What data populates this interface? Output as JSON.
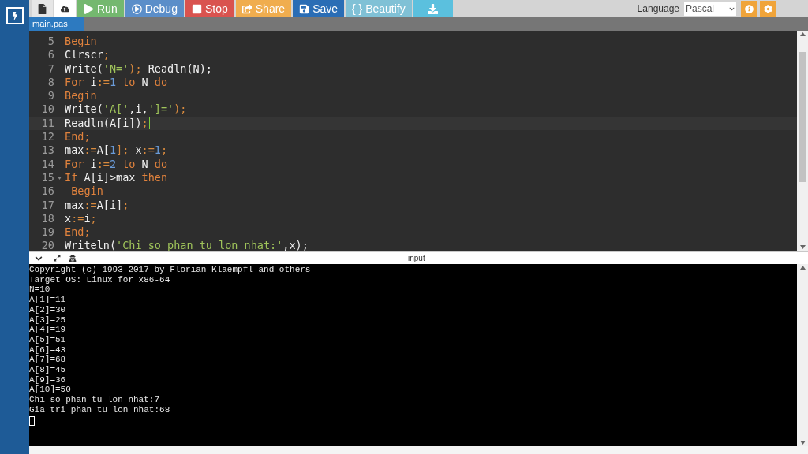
{
  "toolbar": {
    "buttons": [
      {
        "kind": "new"
      },
      {
        "kind": "upload"
      },
      {
        "kind": "run",
        "label": "Run",
        "color": "#74b86f"
      },
      {
        "kind": "debug",
        "label": "Debug",
        "color": "#5b8ec9"
      },
      {
        "kind": "stop",
        "label": "Stop",
        "color": "#d9534f"
      },
      {
        "kind": "share",
        "label": "Share",
        "color": "#f0ad4e"
      },
      {
        "kind": "save",
        "label": "Save",
        "color": "#2a6db5"
      },
      {
        "kind": "beautify",
        "label": "{ } Beautify",
        "color": "#80c1d6"
      },
      {
        "kind": "download",
        "color": "#5bc0de"
      }
    ],
    "language": {
      "label": "Language",
      "value": "Pascal"
    }
  },
  "tabs": [
    {
      "label": "main.pas",
      "selected": true
    }
  ],
  "editor": {
    "lines": [
      {
        "number": "5",
        "active": false,
        "tokens": [
          {
            "text": "Begin",
            "kind": "kw"
          }
        ]
      },
      {
        "number": "6",
        "active": false,
        "tokens": [
          {
            "text": "Clrscr",
            "kind": "id"
          },
          {
            "text": ";",
            "kind": "op"
          }
        ]
      },
      {
        "number": "7",
        "active": false,
        "tokens": [
          {
            "text": "Write(",
            "kind": "id"
          },
          {
            "text": "'N='",
            "kind": "str"
          },
          {
            "text": ");",
            "kind": "op"
          },
          {
            "text": " Readln(N);",
            "kind": "id"
          }
        ]
      },
      {
        "number": "8",
        "active": false,
        "tokens": [
          {
            "text": "For",
            "kind": "kw"
          },
          {
            "text": " i",
            "kind": "id"
          },
          {
            "text": ":=",
            "kind": "op"
          },
          {
            "text": "1",
            "kind": "num"
          },
          {
            "text": " to",
            "kind": "kw"
          },
          {
            "text": " N",
            "kind": "id"
          },
          {
            "text": " do",
            "kind": "kw"
          }
        ]
      },
      {
        "number": "9",
        "active": false,
        "tokens": [
          {
            "text": "Begin",
            "kind": "kw"
          }
        ]
      },
      {
        "number": "10",
        "active": false,
        "tokens": [
          {
            "text": "Write(",
            "kind": "id"
          },
          {
            "text": "'A['",
            "kind": "str"
          },
          {
            "text": ",i,",
            "kind": "id"
          },
          {
            "text": "']='",
            "kind": "str"
          },
          {
            "text": ");",
            "kind": "op"
          }
        ]
      },
      {
        "number": "11",
        "active": true,
        "tokens": [
          {
            "text": "Readln(A[i])",
            "kind": "id"
          },
          {
            "text": ";",
            "kind": "op"
          }
        ]
      },
      {
        "number": "12",
        "active": false,
        "tokens": [
          {
            "text": "End;",
            "kind": "kw"
          }
        ]
      },
      {
        "number": "13",
        "active": false,
        "tokens": [
          {
            "text": "max",
            "kind": "id"
          },
          {
            "text": ":=",
            "kind": "op"
          },
          {
            "text": "A[",
            "kind": "id"
          },
          {
            "text": "1",
            "kind": "num"
          },
          {
            "text": "];",
            "kind": "op"
          },
          {
            "text": " x",
            "kind": "id"
          },
          {
            "text": ":=",
            "kind": "op"
          },
          {
            "text": "1",
            "kind": "num"
          },
          {
            "text": ";",
            "kind": "op"
          }
        ]
      },
      {
        "number": "14",
        "active": false,
        "tokens": [
          {
            "text": "For",
            "kind": "kw"
          },
          {
            "text": " i",
            "kind": "id"
          },
          {
            "text": ":=",
            "kind": "op"
          },
          {
            "text": "2",
            "kind": "num"
          },
          {
            "text": " to",
            "kind": "kw"
          },
          {
            "text": " N",
            "kind": "id"
          },
          {
            "text": " do",
            "kind": "kw"
          }
        ]
      },
      {
        "number": "15",
        "fold": true,
        "active": false,
        "tokens": [
          {
            "text": "If",
            "kind": "kw"
          },
          {
            "text": " A[i]>max",
            "kind": "id"
          },
          {
            "text": " then",
            "kind": "kw"
          }
        ]
      },
      {
        "number": "16",
        "active": false,
        "tokens": [
          {
            "text": " Begin",
            "kind": "kw"
          }
        ]
      },
      {
        "number": "17",
        "active": false,
        "tokens": [
          {
            "text": "max",
            "kind": "id"
          },
          {
            "text": ":=",
            "kind": "op"
          },
          {
            "text": "A[i]",
            "kind": "id"
          },
          {
            "text": ";",
            "kind": "op"
          }
        ]
      },
      {
        "number": "18",
        "active": false,
        "tokens": [
          {
            "text": "x",
            "kind": "id"
          },
          {
            "text": ":=",
            "kind": "op"
          },
          {
            "text": "i",
            "kind": "id"
          },
          {
            "text": ";",
            "kind": "op"
          }
        ]
      },
      {
        "number": "19",
        "active": false,
        "tokens": [
          {
            "text": "End;",
            "kind": "kw"
          }
        ]
      },
      {
        "number": "20",
        "active": false,
        "tokens": [
          {
            "text": "Writeln(",
            "kind": "id"
          },
          {
            "text": "'Chi so phan tu lon nhat:'",
            "kind": "str"
          },
          {
            "text": ",x);",
            "kind": "id"
          }
        ]
      }
    ]
  },
  "console": {
    "title": "input",
    "lines": [
      "Copyright (c) 1993-2017 by Florian Klaempfl and others",
      "Target OS: Linux for x86-64",
      "N=10",
      "A[1]=11",
      "A[2]=30",
      "A[3]=25",
      "A[4]=19",
      "A[5]=51",
      "A[6]=43",
      "A[7]=68",
      "A[8]=45",
      "A[9]=36",
      "A[10]=50",
      "Chi so phan tu lon nhat:7",
      "Gia tri phan tu lon nhat:68"
    ]
  }
}
